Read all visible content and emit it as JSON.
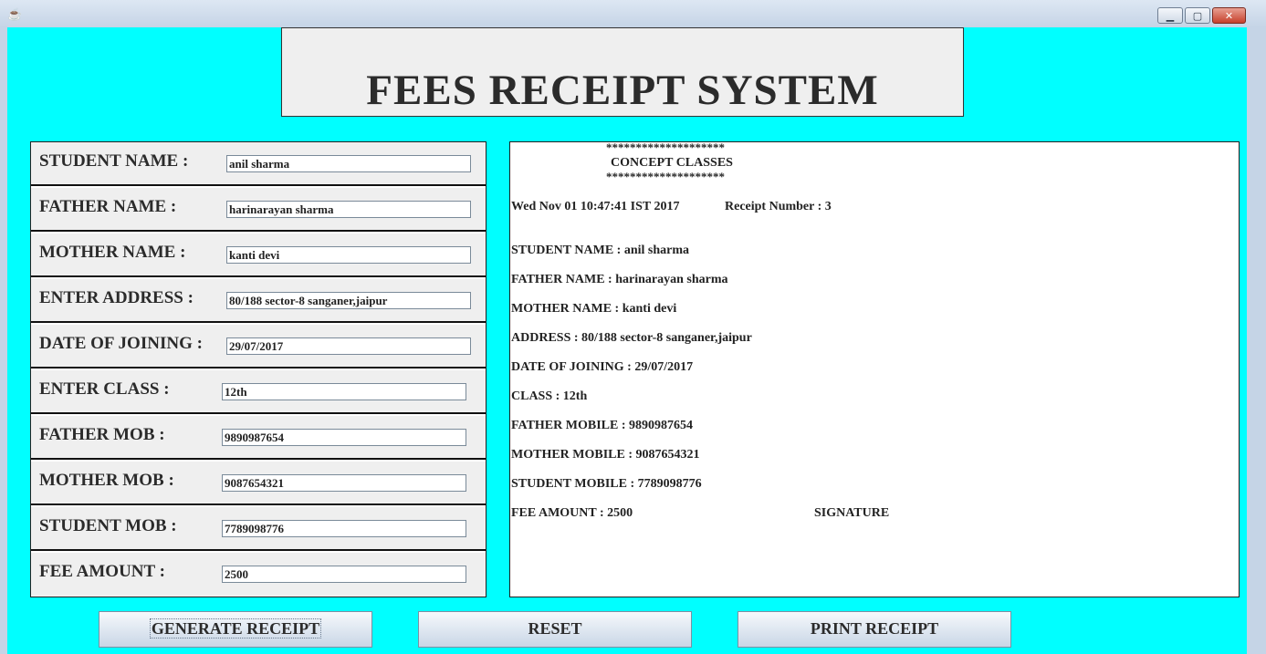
{
  "window": {
    "min_glyph": "▁",
    "max_glyph": "▢",
    "close_glyph": "✕"
  },
  "header": {
    "title": "FEES RECEIPT SYSTEM"
  },
  "form": {
    "fields": [
      {
        "label": "STUDENT NAME :",
        "value": "anil sharma"
      },
      {
        "label": "FATHER NAME :",
        "value": "harinarayan sharma"
      },
      {
        "label": "MOTHER NAME :",
        "value": "kanti devi"
      },
      {
        "label": "ENTER ADDRESS :",
        "value": "80/188 sector-8 sanganer,jaipur"
      },
      {
        "label": "DATE OF JOINING :",
        "value": "29/07/2017"
      },
      {
        "label": "ENTER CLASS :",
        "value": "12th"
      },
      {
        "label": "FATHER MOB :",
        "value": "9890987654"
      },
      {
        "label": "MOTHER MOB :",
        "value": "9087654321"
      },
      {
        "label": "STUDENT MOB :",
        "value": "7789098776"
      },
      {
        "label": "FEE AMOUNT :",
        "value": "2500"
      }
    ]
  },
  "receipt": {
    "stars": "********************",
    "institute": "CONCEPT CLASSES",
    "datetime": "Wed Nov 01 10:47:41 IST 2017",
    "receipt_number": "Receipt Number : 3",
    "lines": [
      "STUDENT NAME : anil sharma",
      "FATHER NAME : harinarayan sharma",
      "MOTHER NAME : kanti devi",
      "ADDRESS : 80/188 sector-8 sanganer,jaipur",
      "DATE OF JOINING : 29/07/2017",
      "CLASS : 12th",
      "FATHER MOBILE : 9890987654",
      "MOTHER MOBILE : 9087654321",
      "STUDENT MOBILE : 7789098776"
    ],
    "fee_amount": "FEE AMOUNT : 2500",
    "signature": "SIGNATURE"
  },
  "buttons": {
    "generate": "GENERATE RECEIPT",
    "reset": "RESET",
    "print": "PRINT RECEIPT"
  },
  "colors": {
    "background": "#00ffff",
    "panel": "#efefef"
  }
}
